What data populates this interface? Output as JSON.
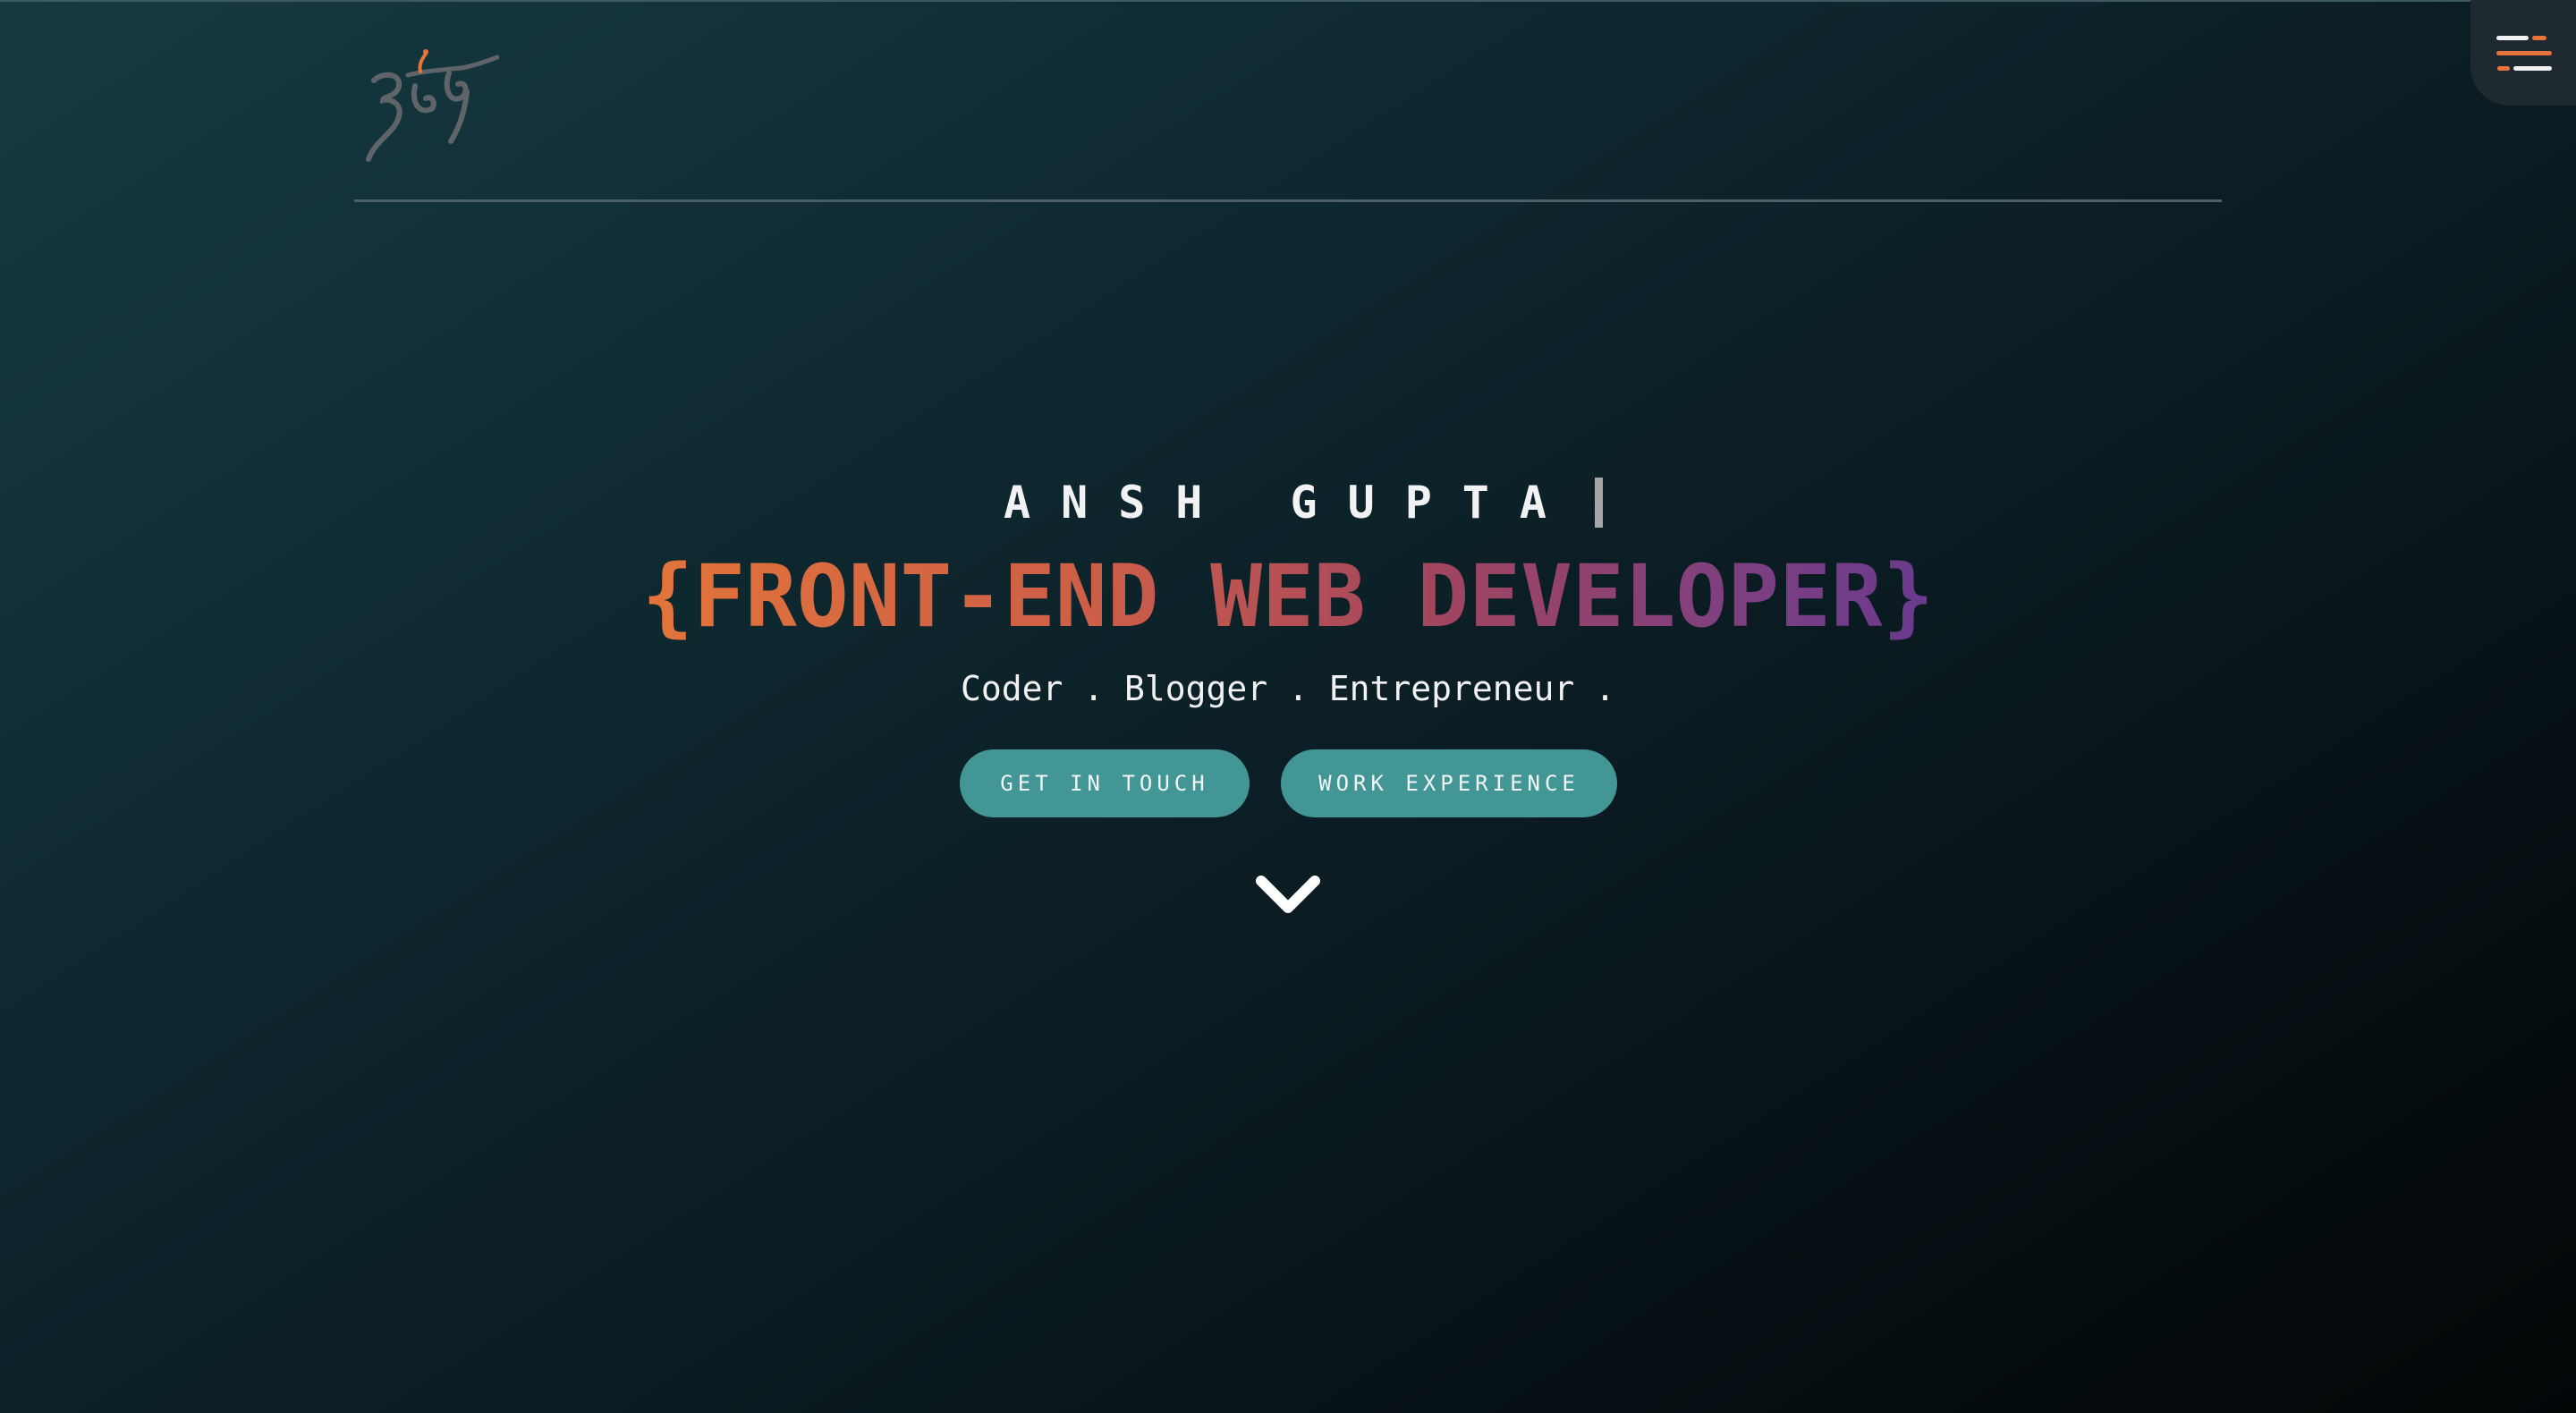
{
  "header": {
    "logo_text": "अंश",
    "menu_icon": "hamburger-menu-icon"
  },
  "hero": {
    "name": "ANSH GUPTA",
    "role_open_brace": "{",
    "role": "FRONT-END WEB DEVELOPER",
    "role_close_brace": "}",
    "tagline": "Coder . Blogger . Entrepreneur .",
    "scroll_icon": "chevron-down-icon"
  },
  "actions": {
    "contact_label": "GET IN TOUCH",
    "work_label": "WORK EXPERIENCE"
  },
  "colors": {
    "accent_orange": "#e8743b",
    "accent_purple": "#6a3a8e",
    "button_teal": "#439696",
    "background_dark": "#0a1a20"
  }
}
